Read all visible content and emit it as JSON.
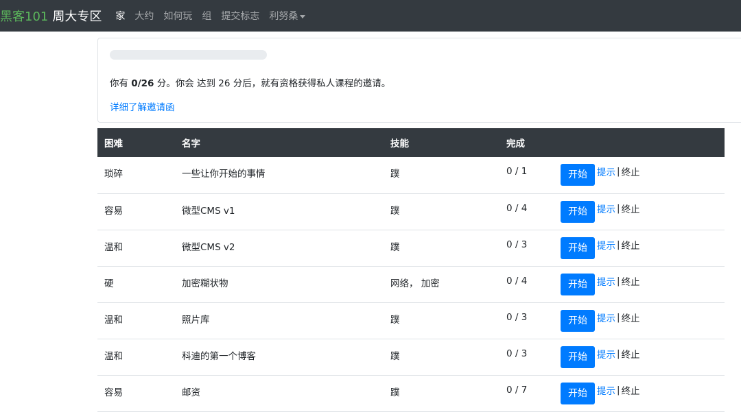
{
  "navbar": {
    "brand_primary": "黑客101",
    "brand_secondary": "周大专区",
    "items": [
      {
        "label": "家"
      },
      {
        "label": "大约"
      },
      {
        "label": "如何玩"
      },
      {
        "label": "组"
      },
      {
        "label": "提交标志"
      },
      {
        "label": "利努桑"
      }
    ]
  },
  "invite": {
    "progress_fraction": 0.0,
    "text_prefix": "你有 ",
    "score": "0/26",
    "text_suffix": " 分。你会 达到 26 分后，就有资格获得私人课程的邀请。",
    "learn_more": "详细了解邀请函"
  },
  "table": {
    "headers": [
      "困难",
      "名字",
      "技能",
      "完成",
      ""
    ],
    "rows": [
      {
        "difficulty": "琐碎",
        "name": "一些让你开始的事情",
        "skills": "蹼",
        "completed": "0 / 1"
      },
      {
        "difficulty": "容易",
        "name": "微型CMS v1",
        "skills": "蹼",
        "completed": "0 / 4"
      },
      {
        "difficulty": "温和",
        "name": "微型CMS v2",
        "skills": "蹼",
        "completed": "0 / 3"
      },
      {
        "difficulty": "硬",
        "name": "加密糊状物",
        "skills": "网络， 加密",
        "completed": "0 / 4"
      },
      {
        "difficulty": "温和",
        "name": "照片库",
        "skills": "蹼",
        "completed": "0 / 3"
      },
      {
        "difficulty": "温和",
        "name": "科迪的第一个博客",
        "skills": "蹼",
        "completed": "0 / 3"
      },
      {
        "difficulty": "容易",
        "name": "邮资",
        "skills": "蹼",
        "completed": "0 / 7"
      }
    ],
    "start_label": "开始",
    "hint_label": "提示",
    "separator": "|",
    "stop_label": "终止"
  },
  "colors": {
    "navbar_bg": "#343a40",
    "brand_accent": "#5cb85c",
    "primary": "#007bff"
  }
}
